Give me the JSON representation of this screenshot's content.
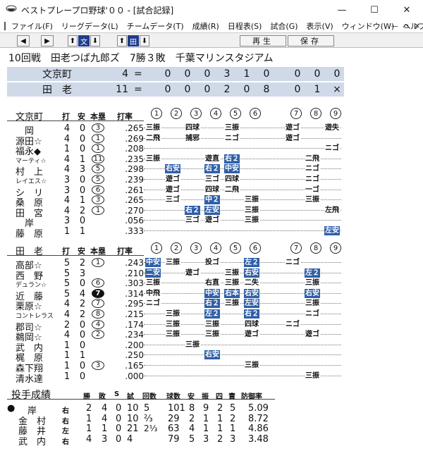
{
  "window": {
    "title": "ベストプレープロ野球'００ - [試合記録]",
    "minimize": "—",
    "maximize": "☐",
    "close": "✕"
  },
  "menu": {
    "items": [
      "ファイル(F)",
      "リーグデータ(L)",
      "チームデータ(T)",
      "成績(R)",
      "日程表(S)",
      "試合(G)",
      "表示(V)",
      "ウィンドウ(W)",
      "ヘルプ(H)"
    ],
    "mdi": [
      "—",
      "▫",
      "✕"
    ]
  },
  "toolbar": {
    "left_arrow": "◀",
    "right_arrow": "▶",
    "up1": "⬆",
    "bun": "文",
    "down1": "⬇",
    "up2": "⬆",
    "den": "田",
    "down2": "⬇",
    "replay": "再生",
    "save": "保存"
  },
  "game": {
    "header": "10回戦　田老つば九郎ズ　7勝３敗　千葉マリンスタジアム"
  },
  "scoreboard": [
    {
      "team": "文京町",
      "total": "4",
      "eq": "=",
      "innings": [
        "0",
        "0",
        "0",
        "3",
        "1",
        "0",
        "0",
        "0",
        "0"
      ]
    },
    {
      "team": "田　老",
      "total": "11",
      "eq": "=",
      "innings": [
        "0",
        "0",
        "0",
        "2",
        "0",
        "8",
        "0",
        "1",
        "×"
      ]
    }
  ],
  "batting_headers": {
    "ab": "打",
    "hit": "安",
    "hr": "本塁",
    "avg": "打率"
  },
  "inning_nums": [
    "1",
    "2",
    "3",
    "4",
    "5",
    "6",
    "7",
    "8",
    "9"
  ],
  "away": {
    "team": "文京町",
    "players": [
      {
        "name": "　岡",
        "ab": "4",
        "hit": "0",
        "hr": "3",
        "avg": ".265",
        "res": [
          [
            0,
            "三振"
          ],
          [
            2,
            "四球"
          ],
          [
            4,
            "三振"
          ],
          [
            6,
            "遊ゴ"
          ],
          [
            8,
            "遊失"
          ]
        ]
      },
      {
        "name": "源田☆",
        "ab": "4",
        "hit": "0",
        "hr": "1",
        "avg": ".269",
        "res": [
          [
            0,
            "二飛"
          ],
          [
            2,
            "捕邪"
          ],
          [
            4,
            "ニゴ"
          ],
          [
            6,
            "遊ゴ"
          ]
        ]
      },
      {
        "name": "福永◆",
        "ab": "1",
        "hit": "0",
        "hr": "1",
        "avg": ".208",
        "res": [
          [
            8,
            "ニゴ"
          ]
        ]
      },
      {
        "name": "マーティ☆",
        "small": true,
        "ab": "4",
        "hit": "1",
        "hr": "11",
        "avg": ".235",
        "res": [
          [
            0,
            "三振"
          ],
          [
            3,
            "遊直"
          ],
          [
            4,
            "右２",
            1
          ],
          [
            7,
            "二飛"
          ]
        ]
      },
      {
        "name": "村　上",
        "ab": "4",
        "hit": "3",
        "hr": "5",
        "avg": ".298",
        "res": [
          [
            1,
            "右安",
            1
          ],
          [
            3,
            "右２",
            1
          ],
          [
            4,
            "中安",
            1
          ],
          [
            7,
            "ニゴ"
          ]
        ]
      },
      {
        "name": "レイエス☆",
        "small": true,
        "ab": "3",
        "hit": "0",
        "hr": "5",
        "avg": ".239",
        "res": [
          [
            1,
            "遊ゴ"
          ],
          [
            3,
            "三ゴ"
          ],
          [
            4,
            "四球"
          ],
          [
            7,
            "ニゴ"
          ]
        ]
      },
      {
        "name": "シ　リ",
        "ab": "3",
        "hit": "0",
        "hr": "6",
        "avg": ".261",
        "res": [
          [
            1,
            "遊ゴ"
          ],
          [
            3,
            "四球"
          ],
          [
            4,
            "二飛"
          ],
          [
            7,
            "一ゴ"
          ]
        ]
      },
      {
        "name": "桑　原",
        "ab": "4",
        "hit": "1",
        "hr": "3",
        "avg": ".265",
        "res": [
          [
            1,
            "三ゴ"
          ],
          [
            3,
            "中２",
            1
          ],
          [
            5,
            "三振"
          ],
          [
            7,
            "三振"
          ]
        ]
      },
      {
        "name": "田　宮",
        "ab": "4",
        "hit": "2",
        "hr": "1",
        "avg": ".270",
        "res": [
          [
            2,
            "右２",
            1
          ],
          [
            3,
            "左安",
            1
          ],
          [
            5,
            "三振"
          ],
          [
            8,
            "左飛"
          ]
        ]
      },
      {
        "name": "　岸",
        "ab": "3",
        "hit": "0",
        "hr": "",
        "avg": ".056",
        "res": [
          [
            2,
            "三ゴ"
          ],
          [
            3,
            "遊ゴ"
          ],
          [
            5,
            "三振"
          ]
        ]
      },
      {
        "name": "藤　原",
        "ab": "1",
        "hit": "1",
        "hr": "",
        "avg": ".333",
        "res": [
          [
            8,
            "左安",
            1
          ]
        ]
      }
    ]
  },
  "home": {
    "team": "田　老",
    "players": [
      {
        "name": "高部☆",
        "ab": "5",
        "hit": "2",
        "hr": "1",
        "avg": ".243",
        "res": [
          [
            0,
            "中安",
            1
          ],
          [
            1,
            "三振"
          ],
          [
            3,
            "投ゴ"
          ],
          [
            5,
            "左２",
            1
          ],
          [
            6,
            "ニゴ"
          ]
        ]
      },
      {
        "name": "西　野",
        "ab": "5",
        "hit": "3",
        "hr": "",
        "avg": ".210",
        "res": [
          [
            0,
            "二安",
            1
          ],
          [
            2,
            "遊ゴ"
          ],
          [
            4,
            "三振"
          ],
          [
            5,
            "右安",
            1
          ],
          [
            7,
            "左２",
            1
          ]
        ]
      },
      {
        "name": "デュラン☆",
        "small": true,
        "ab": "5",
        "hit": "0",
        "hr": "6",
        "avg": ".303",
        "res": [
          [
            0,
            "三振"
          ],
          [
            3,
            "右直"
          ],
          [
            4,
            "三振"
          ],
          [
            5,
            "二失"
          ],
          [
            7,
            "三振"
          ]
        ]
      },
      {
        "name": "近　藤",
        "ab": "5",
        "hit": "4",
        "hr": "7",
        "hrFilled": true,
        "avg": ".314",
        "res": [
          [
            0,
            "中飛"
          ],
          [
            3,
            "中安",
            1
          ],
          [
            4,
            "右本",
            1
          ],
          [
            5,
            "右安",
            1
          ],
          [
            7,
            "右安",
            1
          ]
        ]
      },
      {
        "name": "栗原☆",
        "ab": "4",
        "hit": "2",
        "hr": "7",
        "avg": ".295",
        "res": [
          [
            0,
            "ニゴ"
          ],
          [
            3,
            "右２",
            1
          ],
          [
            4,
            "三振"
          ],
          [
            5,
            "左安",
            1
          ],
          [
            7,
            "三振"
          ]
        ]
      },
      {
        "name": "コントレラス",
        "small": true,
        "ab": "4",
        "hit": "2",
        "hr": "8",
        "avg": ".215",
        "res": [
          [
            1,
            "三振"
          ],
          [
            3,
            "左２",
            1
          ],
          [
            5,
            "右２",
            1
          ],
          [
            7,
            "ニゴ"
          ]
        ]
      },
      {
        "name": "郡司☆",
        "ab": "2",
        "hit": "0",
        "hr": "4",
        "avg": ".174",
        "res": [
          [
            1,
            "三振"
          ],
          [
            3,
            "三振"
          ],
          [
            5,
            "四球"
          ],
          [
            6,
            "ニゴ"
          ]
        ]
      },
      {
        "name": "鵜岡☆",
        "ab": "4",
        "hit": "0",
        "hr": "2",
        "avg": ".234",
        "res": [
          [
            1,
            "三振"
          ],
          [
            3,
            "三振"
          ],
          [
            5,
            "遊ゴ"
          ],
          [
            7,
            "遊ゴ"
          ]
        ]
      },
      {
        "name": "武　内",
        "ab": "1",
        "hit": "0",
        "hr": "",
        "avg": ".200",
        "res": [
          [
            2,
            "三振"
          ]
        ]
      },
      {
        "name": "梶　原",
        "ab": "1",
        "hit": "1",
        "hr": "",
        "avg": ".250",
        "res": [
          [
            3,
            "右安",
            1
          ]
        ]
      },
      {
        "name": "森下翔",
        "ab": "1",
        "hit": "0",
        "hr": "3",
        "avg": ".165",
        "res": [
          [
            5,
            "三振"
          ]
        ]
      },
      {
        "name": "清水達",
        "ab": "1",
        "hit": "0",
        "hr": "",
        "avg": ".000",
        "res": [
          [
            7,
            "三振"
          ]
        ]
      }
    ]
  },
  "pitching": {
    "title": "投手成績",
    "headers": [
      "勝",
      "敗",
      "S",
      "試",
      "回数",
      "球数",
      "安",
      "振",
      "四",
      "責",
      "防御率"
    ],
    "rows": [
      {
        "mark": "●",
        "name": "　岸",
        "hand": "右",
        "w": "2",
        "l": "4",
        "s": "0",
        "g": "10",
        "ip": "5",
        "pc": "101",
        "h": "8",
        "so": "9",
        "bb": "2",
        "er": "5",
        "era": "5.09"
      },
      {
        "mark": "",
        "name": "金　村",
        "hand": "右",
        "w": "1",
        "l": "4",
        "s": "0",
        "g": "10",
        "ip": "⅔",
        "pc": "29",
        "h": "2",
        "so": "1",
        "bb": "1",
        "er": "2",
        "era": "8.72"
      },
      {
        "mark": "",
        "name": "藤　井",
        "hand": "左",
        "w": "1",
        "l": "1",
        "s": "0",
        "g": "21",
        "ip": "2⅓",
        "pc": "63",
        "h": "4",
        "so": "1",
        "bb": "1",
        "er": "1",
        "era": "4.86"
      },
      {
        "mark": "",
        "name": "武　内",
        "hand": "右",
        "w": "4",
        "l": "3",
        "s": "0",
        "g": "4",
        "ip": "",
        "pc": "79",
        "h": "5",
        "so": "3",
        "bb": "2",
        "er": "3",
        "era": "3.48"
      }
    ]
  }
}
